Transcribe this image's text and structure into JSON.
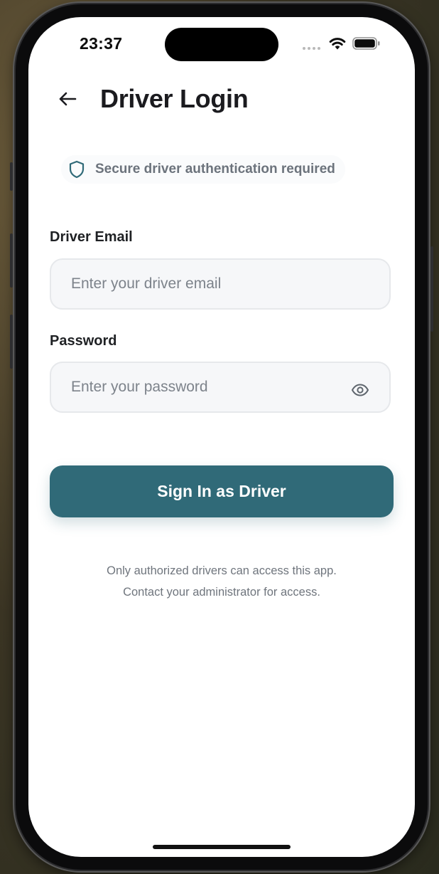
{
  "status_bar": {
    "time": "23:37",
    "signal_icon": "cellular-signal-icon",
    "wifi_icon": "wifi-icon",
    "battery_icon": "battery-icon"
  },
  "header": {
    "back_icon": "back-arrow-icon",
    "title": "Driver Login"
  },
  "notice": {
    "icon": "shield-icon",
    "text": "Secure driver authentication required"
  },
  "form": {
    "email_label": "Driver Email",
    "email_placeholder": "Enter your driver email",
    "email_value": "",
    "password_label": "Password",
    "password_placeholder": "Enter your password",
    "password_value": "",
    "password_toggle_icon": "eye-icon",
    "submit_label": "Sign In as Driver"
  },
  "footer": {
    "line1": "Only authorized drivers can access this app.",
    "line2": "Contact your administrator for access."
  },
  "colors": {
    "primary": "#306a78",
    "input_bg": "#f6f7f9",
    "input_border": "#e6e8eb",
    "muted_text": "#6c737c"
  }
}
